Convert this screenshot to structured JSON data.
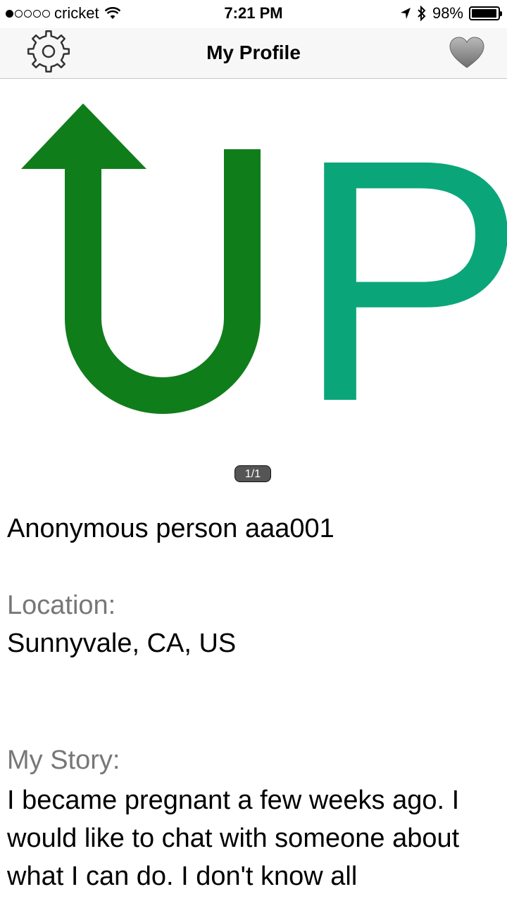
{
  "status_bar": {
    "carrier": "cricket",
    "time": "7:21 PM",
    "battery": "98%",
    "battery_level": 0.98,
    "signal_bars_filled": 1
  },
  "nav": {
    "title": "My Profile",
    "left_icon": "gear-icon",
    "right_icon": "heart-icon"
  },
  "logo": {
    "letter_p": "P",
    "colors": {
      "arrow_u": "#107d1b",
      "p": "#0aa67a"
    }
  },
  "pager": "1/1",
  "profile": {
    "name": "Anonymous person aaa001",
    "location_label": "Location:",
    "location": "Sunnyvale, CA, US",
    "story_label": "My Story:",
    "story": "I became pregnant a few weeks ago.  I would like to chat with someone about what I can do.  I don't know all"
  }
}
